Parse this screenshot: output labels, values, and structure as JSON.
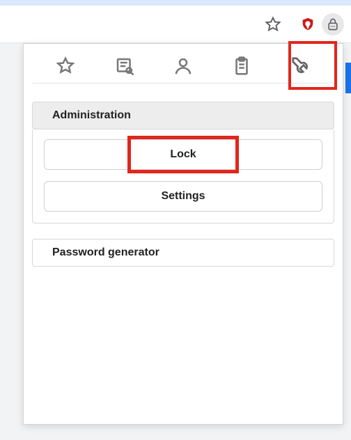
{
  "colors": {
    "highlight": "#e1261c",
    "shield": "#d01818"
  },
  "browser": {
    "bookmark_icon": "star-outline",
    "extensions": [
      {
        "name": "shield",
        "active": false
      },
      {
        "name": "password-manager-lock",
        "active": true
      }
    ]
  },
  "dropdown": {
    "tabs": [
      {
        "name": "favorites",
        "icon": "star"
      },
      {
        "name": "notes",
        "icon": "note-search"
      },
      {
        "name": "contacts",
        "icon": "person"
      },
      {
        "name": "clipboard",
        "icon": "clipboard"
      },
      {
        "name": "tools",
        "icon": "wrench",
        "active": true,
        "highlighted": true
      }
    ],
    "sections": {
      "administration": {
        "title": "Administration",
        "buttons": {
          "lock": {
            "label": "Lock",
            "highlighted": true
          },
          "settings": {
            "label": "Settings"
          }
        }
      },
      "password_generator": {
        "title": "Password generator"
      }
    }
  }
}
